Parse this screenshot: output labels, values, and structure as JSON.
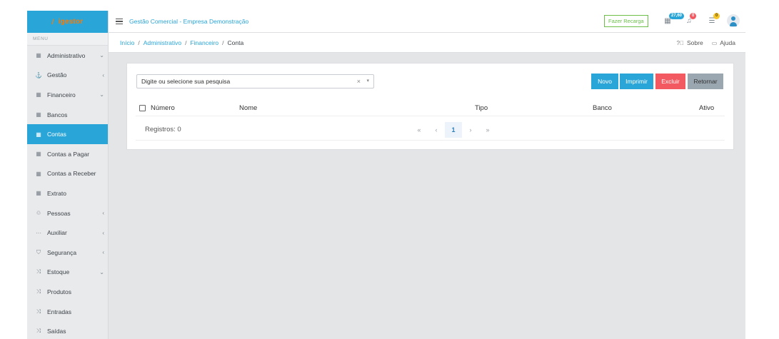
{
  "brand": {
    "name": "igestor"
  },
  "sidebar": {
    "caption": "MENU",
    "items": [
      {
        "label": "Administrativo",
        "icon": "▦",
        "caret": "⌄",
        "active": false
      },
      {
        "label": "Gestão",
        "icon": "⚓",
        "caret": "‹",
        "active": false
      },
      {
        "label": "Financeiro",
        "icon": "▦",
        "caret": "⌄",
        "active": false
      },
      {
        "label": "Bancos",
        "icon": "▦",
        "caret": "",
        "active": false
      },
      {
        "label": "Contas",
        "icon": "▦",
        "caret": "",
        "active": true
      },
      {
        "label": "Contas a Pagar",
        "icon": "▦",
        "caret": "",
        "active": false
      },
      {
        "label": "Contas a Receber",
        "icon": "▦",
        "caret": "",
        "active": false
      },
      {
        "label": "Extrato",
        "icon": "▦",
        "caret": "",
        "active": false
      },
      {
        "label": "Pessoas",
        "icon": "♲",
        "caret": "‹",
        "active": false
      },
      {
        "label": "Auxiliar",
        "icon": "···",
        "caret": "‹",
        "active": false
      },
      {
        "label": "Segurança",
        "icon": "⛉",
        "caret": "‹",
        "active": false
      },
      {
        "label": "Estoque",
        "icon": "⤨",
        "caret": "⌄",
        "active": false
      },
      {
        "label": "Produtos",
        "icon": "⤨",
        "caret": "",
        "active": false
      },
      {
        "label": "Entradas",
        "icon": "⤨",
        "caret": "",
        "active": false
      },
      {
        "label": "Saídas",
        "icon": "⤨",
        "caret": "",
        "active": false
      }
    ]
  },
  "topbar": {
    "title": "Gestão Comercial - Empresa Demonstração",
    "recharge_label": "Fazer Recarga",
    "credit_badge": "27,60",
    "notifications_badge": "0",
    "tasks_badge": "0"
  },
  "breadcrumb": {
    "items": [
      "Início",
      "Administrativo",
      "Financeiro"
    ],
    "current": "Conta",
    "separator": "/"
  },
  "help": {
    "about_label": "Sobre",
    "help_label": "Ajuda"
  },
  "search": {
    "placeholder": "Digite ou selecione sua pesquisa",
    "clear": "×",
    "caret": "▾"
  },
  "actions": {
    "new_label": "Novo",
    "print_label": "Imprimir",
    "delete_label": "Excluir",
    "back_label": "Retornar"
  },
  "table": {
    "columns": [
      "Número",
      "Nome",
      "Tipo",
      "Banco",
      "Ativo"
    ],
    "records_text": "Registros: 0"
  },
  "pagination": {
    "first": "«",
    "prev": "‹",
    "current_page": "1",
    "next": "›",
    "last": "»"
  },
  "colors": {
    "accent": "#2aa5d8",
    "brand_text": "#ff7a00",
    "new_button": "#2aa5d8",
    "print_button": "#2aa5d8",
    "delete_button": "#f25961",
    "back_button": "#9aa6b0",
    "recharge_border": "#6cc04a",
    "credit_badge": "#2aa5d8",
    "notifications_badge": "#f25961",
    "tasks_badge": "#f7c52c"
  }
}
